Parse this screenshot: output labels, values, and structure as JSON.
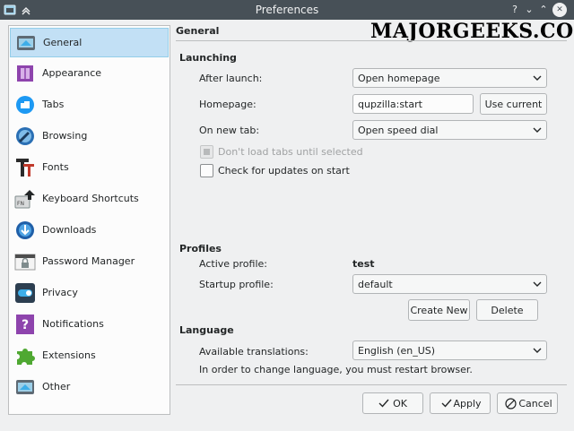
{
  "window": {
    "title": "Preferences",
    "controls": [
      "?",
      "⌄",
      "⌃",
      "✕"
    ]
  },
  "watermark": "MAJORGEEKS.COM",
  "sidebar": {
    "items": [
      {
        "label": "General",
        "icon": "general-icon",
        "active": true
      },
      {
        "label": "Appearance",
        "icon": "appearance-icon"
      },
      {
        "label": "Tabs",
        "icon": "tabs-icon"
      },
      {
        "label": "Browsing",
        "icon": "browsing-icon"
      },
      {
        "label": "Fonts",
        "icon": "fonts-icon"
      },
      {
        "label": "Keyboard Shortcuts",
        "icon": "keyboard-shortcuts-icon"
      },
      {
        "label": "Downloads",
        "icon": "downloads-icon"
      },
      {
        "label": "Password Manager",
        "icon": "password-manager-icon"
      },
      {
        "label": "Privacy",
        "icon": "privacy-icon"
      },
      {
        "label": "Notifications",
        "icon": "notifications-icon"
      },
      {
        "label": "Extensions",
        "icon": "extensions-icon"
      },
      {
        "label": "Other",
        "icon": "other-icon"
      }
    ]
  },
  "page": {
    "title": "General"
  },
  "launching": {
    "heading": "Launching",
    "after_launch_label": "After launch:",
    "after_launch_value": "Open homepage",
    "homepage_label": "Homepage:",
    "homepage_value": "qupzilla:start",
    "use_current_label": "Use current",
    "new_tab_label": "On new tab:",
    "new_tab_value": "Open speed dial",
    "dont_load_tabs_label": "Don't load tabs until selected",
    "check_updates_label": "Check for updates on start"
  },
  "profiles": {
    "heading": "Profiles",
    "active_label": "Active profile:",
    "active_value": "test",
    "startup_label": "Startup profile:",
    "startup_value": "default",
    "create_new_label": "Create New",
    "delete_label": "Delete"
  },
  "language": {
    "heading": "Language",
    "translations_label": "Available translations:",
    "translations_value": "English (en_US)",
    "note": "In order to change language, you must restart browser."
  },
  "footer": {
    "ok_label": "OK",
    "apply_label": "Apply",
    "cancel_label": "Cancel"
  },
  "colors": {
    "titlebar": "#475057",
    "selection": "#c2e0f5",
    "window": "#eff0f1"
  }
}
